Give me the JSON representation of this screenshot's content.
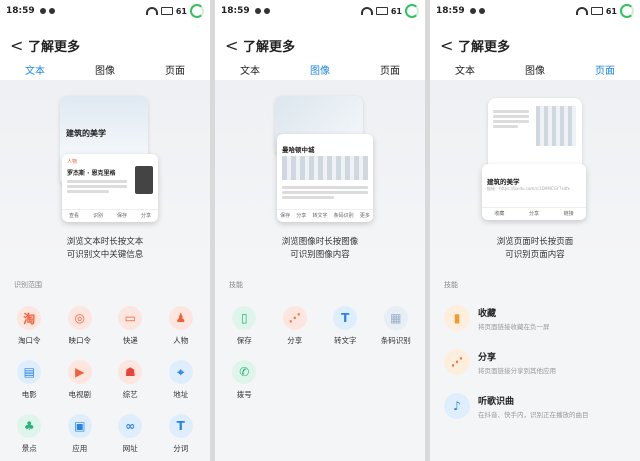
{
  "status": {
    "time": "18:59",
    "battery": "61"
  },
  "header": {
    "back": "<",
    "title": "了解更多"
  },
  "tabs": [
    "文本",
    "图像",
    "页面"
  ],
  "colors": {
    "accent": "#1e88e5",
    "ring": "#33c15f"
  },
  "p1": {
    "card_title": "建筑的美学",
    "label": "人物",
    "person_name": "罗杰斯 · 恩克里格",
    "actions": [
      "查看",
      "识别",
      "保存",
      "分享"
    ],
    "caption": [
      "浏览文本时长按文本",
      "可识别文中关键信息"
    ],
    "section": "识别范围",
    "items": [
      {
        "label": "淘口令",
        "icon": "淘",
        "bg": "#fde6df",
        "fg": "#f0603a"
      },
      {
        "label": "映口令",
        "icon": "◎",
        "bg": "#fde6df",
        "fg": "#f0603a"
      },
      {
        "label": "快递",
        "icon": "▭",
        "bg": "#fde6df",
        "fg": "#f0603a"
      },
      {
        "label": "人物",
        "icon": "♟",
        "bg": "#fde6df",
        "fg": "#f0603a"
      },
      {
        "label": "电影",
        "icon": "▤",
        "bg": "#dfeefd",
        "fg": "#2b83e0"
      },
      {
        "label": "电视剧",
        "icon": "▶",
        "bg": "#fde6df",
        "fg": "#f0603a"
      },
      {
        "label": "综艺",
        "icon": "☗",
        "bg": "#fde6df",
        "fg": "#e8453a"
      },
      {
        "label": "地址",
        "icon": "⌖",
        "bg": "#dfeefd",
        "fg": "#2b83e0"
      },
      {
        "label": "景点",
        "icon": "♣",
        "bg": "#dff5ec",
        "fg": "#27b27a"
      },
      {
        "label": "应用",
        "icon": "▣",
        "bg": "#dfeefd",
        "fg": "#2b83e0"
      },
      {
        "label": "网址",
        "icon": "∞",
        "bg": "#dfeefd",
        "fg": "#2b83e0"
      },
      {
        "label": "分词",
        "icon": "T",
        "bg": "#dfeefd",
        "fg": "#2b83e0"
      }
    ]
  },
  "p2": {
    "card_title": "曼哈顿中城",
    "actions": [
      "保存",
      "分享",
      "转文字",
      "条码识别",
      "更多"
    ],
    "caption": [
      "浏览图像时长按图像",
      "可识别图像内容"
    ],
    "section": "技能",
    "items": [
      {
        "label": "保存",
        "icon": "▯",
        "bg": "#dff5ec",
        "fg": "#27b27a"
      },
      {
        "label": "分享",
        "icon": "⋰",
        "bg": "#fde6df",
        "fg": "#f07a3a"
      },
      {
        "label": "转文字",
        "icon": "T",
        "bg": "#dfeefd",
        "fg": "#2b83e0"
      },
      {
        "label": "条码识别",
        "icon": "▦",
        "bg": "#e8eef6",
        "fg": "#9ab0c8"
      },
      {
        "label": "拨号",
        "icon": "✆",
        "bg": "#dff5ec",
        "fg": "#27b27a"
      }
    ]
  },
  "p3": {
    "card_title": "建筑的美学",
    "url_text": "链接：https://baidu.com/s/1DAMCGY7sdfx",
    "actions": [
      "收藏",
      "分享",
      "链接"
    ],
    "caption": [
      "浏览页面时长按页面",
      "可识别页面内容"
    ],
    "section": "技能",
    "items": [
      {
        "title": "收藏",
        "desc": "将页面链接收藏在负一屏",
        "icon": "▮",
        "bg": "#fdeede",
        "fg": "#f39a2c"
      },
      {
        "title": "分享",
        "desc": "将页面链接分享到其他应用",
        "icon": "⋰",
        "bg": "#fdeede",
        "fg": "#f07a3a"
      },
      {
        "title": "听歌识曲",
        "desc": "在抖音、快手内，识别正在播放的曲目",
        "icon": "♪",
        "bg": "#dfeefd",
        "fg": "#2b83e0"
      }
    ]
  }
}
